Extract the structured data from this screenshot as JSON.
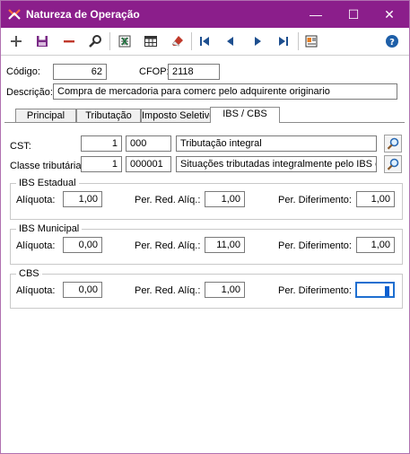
{
  "window": {
    "title": "Natureza de Operação",
    "minimize": "—",
    "maximize": "☐",
    "close": "✕",
    "accent": "#8b1e8b"
  },
  "toolbar": {
    "buttons": [
      "add-icon",
      "save-icon",
      "delete-icon",
      "search-icon",
      "export-excel-icon",
      "grid-icon",
      "eraser-icon",
      "first-record-icon",
      "previous-record-icon",
      "next-record-icon",
      "last-record-icon",
      "report-icon",
      "help-icon"
    ]
  },
  "header": {
    "codigo_label": "Código:",
    "codigo_value": "62",
    "cfop_label": "CFOP:",
    "cfop_value": "2118",
    "descricao_label": "Descrição:",
    "descricao_value": "Compra de mercadoria para comerc pelo adquirente originario"
  },
  "tabs": [
    {
      "label": "Principal"
    },
    {
      "label": "Tributação"
    },
    {
      "label": "Imposto Seletivo"
    },
    {
      "label": "IBS / CBS"
    }
  ],
  "active_tab": "IBS / CBS",
  "ibs_cbs": {
    "cst_label": "CST:",
    "cst_num": "1",
    "cst_code": "000",
    "cst_desc": "Tributação integral",
    "classe_label": "Classe tributária:",
    "classe_num": "1",
    "classe_code": "000001",
    "classe_desc": "Situações tributadas integralmente pelo IBS e CBS.",
    "groups": [
      {
        "title": "IBS Estadual",
        "aliquota_label": "Alíquota:",
        "aliquota": "1,00",
        "red_label": "Per. Red. Alíq.:",
        "red": "1,00",
        "dif_label": "Per. Diferimento:",
        "dif": "1,00"
      },
      {
        "title": "IBS Municipal",
        "aliquota_label": "Alíquota:",
        "aliquota": "0,00",
        "red_label": "Per. Red. Alíq.:",
        "red": "11,00",
        "dif_label": "Per. Diferimento:",
        "dif": "1,00"
      },
      {
        "title": "CBS",
        "aliquota_label": "Alíquota:",
        "aliquota": "0,00",
        "red_label": "Per. Red. Alíq.:",
        "red": "1,00",
        "dif_label": "Per. Diferimento:",
        "dif": ""
      }
    ]
  }
}
